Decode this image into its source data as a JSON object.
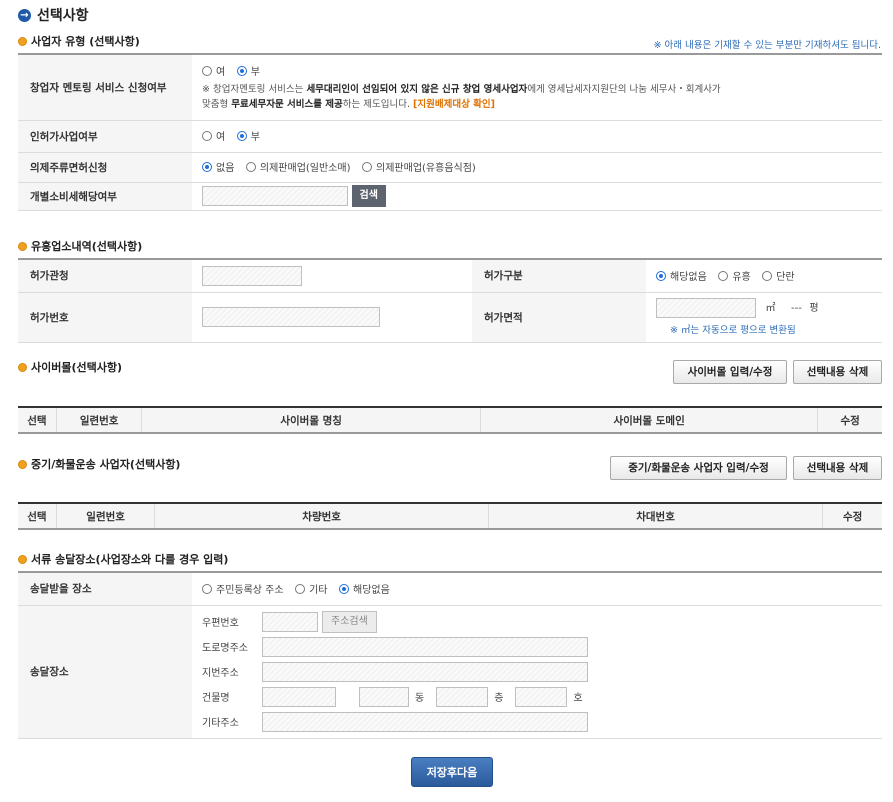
{
  "page": {
    "title": "선택사항"
  },
  "biz_type": {
    "heading": "사업자 유형 (선택사항)",
    "notice": "※ 아래 내용은 기재할 수 있는 부분만 기재하셔도 됩니다.",
    "mentoring": {
      "label": "창업자 멘토링 서비스 신청여부",
      "opt_yes": "여",
      "opt_no": "부",
      "selected": "부",
      "desc_1": "※ 창업자멘토링 서비스는",
      "desc_2": "세무대리인이 선임되어 있지 않은 신규 창업 영세사업자",
      "desc_3": "에게 영세납세자지원단의 나눔 세무사・회계사가",
      "desc_4": "맞춤형",
      "desc_5": "무료세무자문 서비스를 제공",
      "desc_6": "하는 제도입니다.",
      "desc_link": "[지원배제대상 확인]"
    },
    "license": {
      "label": "인허가사업여부",
      "opt_yes": "여",
      "opt_no": "부",
      "selected": "부"
    },
    "liquor": {
      "label": "의제주류면허신청",
      "opt_1": "없음",
      "opt_2": "의제판매업(일반소매)",
      "opt_3": "의제판매업(유흥음식점)",
      "selected": "없음"
    },
    "excise": {
      "label": "개별소비세해당여부",
      "value": "",
      "search_button": "검색"
    }
  },
  "entertainment": {
    "heading": "유흥업소내역(선택사항)",
    "office_label": "허가관청",
    "office_value": "",
    "kind_label": "허가구분",
    "kind_opt_1": "해당없음",
    "kind_opt_2": "유흥",
    "kind_opt_3": "단란",
    "kind_selected": "해당없음",
    "number_label": "허가번호",
    "number_value": "",
    "area_label": "허가면적",
    "area_value": "",
    "area_unit": "㎡",
    "pyeong_value": "---",
    "pyeong_unit": "평",
    "area_note": "※ ㎡는 자동으로 평으로 변환됨"
  },
  "cyber_mall": {
    "heading": "사이버몰(선택사항)",
    "input_button": "사이버몰 입력/수정",
    "delete_button": "선택내용 삭제",
    "columns": [
      "선택",
      "일련번호",
      "사이버몰 명칭",
      "사이버몰 도메인",
      "수정"
    ]
  },
  "freight": {
    "heading": "중기/화물운송 사업자(선택사항)",
    "input_button": "중기/화물운송 사업자 입력/수정",
    "delete_button": "선택내용 삭제",
    "columns": [
      "선택",
      "일련번호",
      "차량번호",
      "차대번호",
      "수정"
    ]
  },
  "delivery": {
    "heading": "서류 송달장소(사업장소와 다를 경우 입력)",
    "place_label": "송달받을 장소",
    "opt_1": "주민등록상 주소",
    "opt_2": "기타",
    "opt_3": "해당없음",
    "selected": "해당없음",
    "address_label": "송달장소",
    "zip_label": "우편번호",
    "zip_value": "",
    "zip_button": "주소검색",
    "road_label": "도로명주소",
    "road_value": "",
    "lot_label": "지번주소",
    "lot_value": "",
    "building_label": "건물명",
    "building_value": "",
    "dong_value": "",
    "dong_unit": "동",
    "floor_value": "",
    "floor_unit": "층",
    "ho_value": "",
    "ho_unit": "호",
    "etc_label": "기타주소",
    "etc_value": ""
  },
  "footer": {
    "save_button": "저장후다음"
  },
  "colors": {
    "accent": "#1f5aa8",
    "bullet": "#f0a020",
    "link_orange": "#e07000",
    "notice_blue": "#2a6bb8"
  }
}
